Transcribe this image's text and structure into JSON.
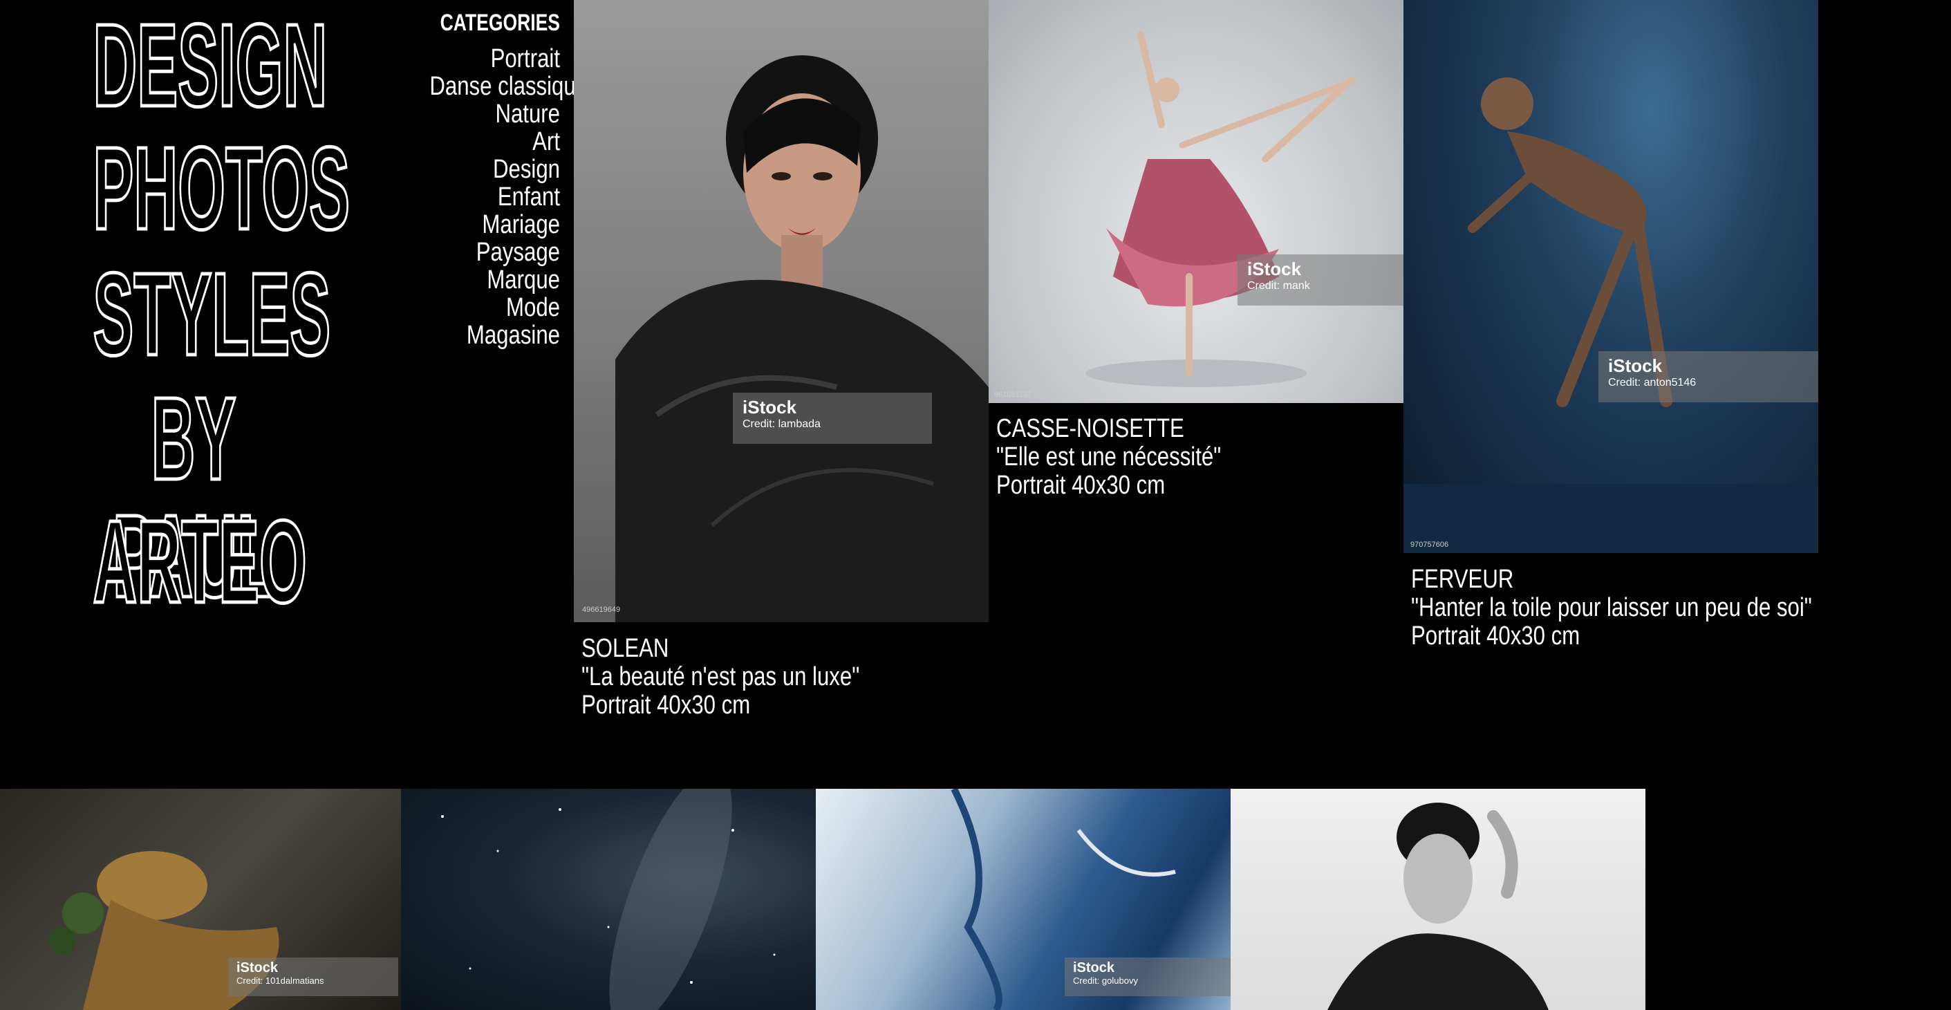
{
  "title": {
    "lines": [
      "DESIGN",
      "PHOTOS",
      "STYLES",
      "BY PAUL",
      "ARTEO"
    ]
  },
  "categories": {
    "heading": "CATEGORIES",
    "items": [
      "Portrait",
      "Danse classique",
      "Nature",
      "Art",
      "Design",
      "Enfant",
      "Mariage",
      "Paysage",
      "Marque",
      "Mode",
      "Magasine"
    ]
  },
  "photos": [
    {
      "name": "SOLEAN",
      "quote": "\"La beauté n'est pas un luxe\"",
      "format": "Portrait 40x30 cm",
      "watermark": "iStock",
      "credit": "Credit: lambada",
      "id": "496619649"
    },
    {
      "name": "CASSE-NOISETTE",
      "quote": "\"Elle est une nécessité\"",
      "format": "Portrait 40x30 cm",
      "watermark": "iStock",
      "credit": "Credit: mank",
      "id": "961051137"
    },
    {
      "name": "FERVEUR",
      "quote": "\"Hanter la toile pour laisser un peu de soi\"",
      "format": "Portrait 40x30 cm",
      "watermark": "iStock",
      "credit": "Credit: anton5146",
      "id": "970757606"
    }
  ],
  "bottom_photos": [
    {
      "watermark": "iStock",
      "credit": "Credit: 101dalmatians"
    },
    {
      "watermark": "",
      "credit": ""
    },
    {
      "watermark": "iStock",
      "credit": "Credit: golubovy"
    },
    {
      "watermark": "",
      "credit": ""
    }
  ]
}
